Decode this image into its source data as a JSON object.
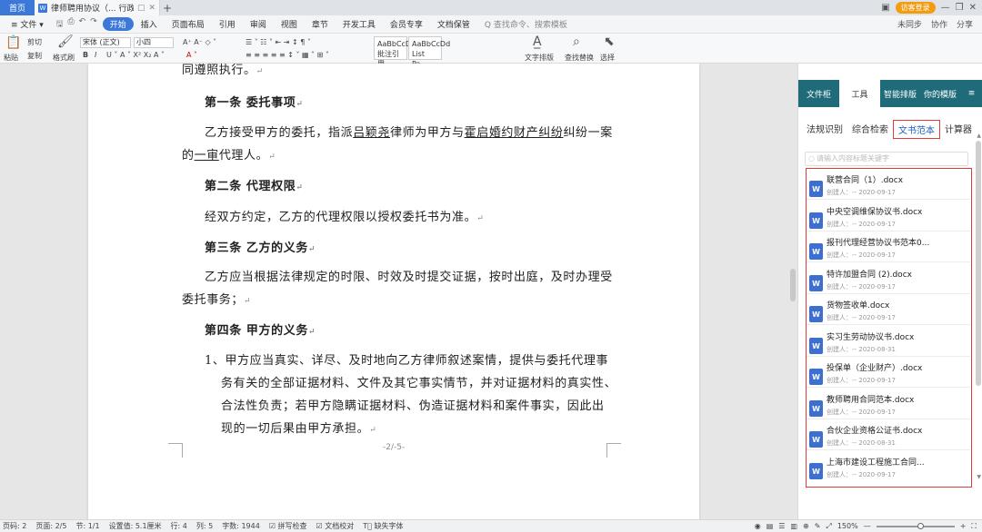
{
  "titlebar": {
    "home_tab": "首页",
    "doc_tab_icon": "W",
    "doc_tab": "律师聘用协议（... 行政）(1)",
    "login": "访客登录",
    "icons": [
      "window-icon",
      "minimize-icon",
      "restore-icon",
      "close-icon"
    ]
  },
  "menubar": {
    "file": "≡ 文件 ▾",
    "items": [
      "开始",
      "插入",
      "页面布局",
      "引用",
      "审阅",
      "视图",
      "章节",
      "开发工具",
      "会员专享",
      "文档保管"
    ],
    "active": "开始",
    "search_cmd": "Q 查找命令、搜索模板",
    "right": [
      "未同步",
      "协作",
      "分享"
    ]
  },
  "ribbon": {
    "paste": "粘贴",
    "cut": "剪切",
    "copy": "复制",
    "format_painter": "格式刷",
    "font": "宋体 (正文)",
    "size": "小四",
    "style1": "AaBbCcDd",
    "style1_name": "批注引用",
    "style2": "AaBbCcDd",
    "style2_name": "List Pa...",
    "text_layout": "文字排版",
    "find_replace": "查找替换",
    "select": "选择"
  },
  "document": {
    "line0": "同遵照执行。",
    "h1": "第一条  委托事项",
    "p1a_pre": "乙方接受甲方的委托，指派",
    "p1a_lawyer": "吕颖尧",
    "p1a_mid": "律师为甲方与",
    "p1a_case": "霍启婚约财产纠纷",
    "p1a_post": "纠纷一案",
    "p1b_pre": "的",
    "p1b_u": "一审",
    "p1b_post": "代理人。",
    "h2": "第二条  代理权限",
    "p2": "经双方约定，乙方的代理权限以授权委托书为准。",
    "h3": "第三条  乙方的义务",
    "p3a": "乙方应当根据法律规定的时限、时效及时提交证据，按时出庭，及时办理受",
    "p3b": "委托事务；",
    "h4": "第四条  甲方的义务",
    "p4a": "1、甲方应当真实、详尽、及时地向乙方律师叙述案情，提供与委托代理事",
    "p4b": "务有关的全部证据材料、文件及其它事实情节，并对证据材料的真实性、",
    "p4c": "合法性负责；若甲方隐瞒证据材料、伪造证据材料和案件事实，因此出",
    "p4d": "现的一切后果由甲方承担。",
    "footer": "-2/-5-"
  },
  "pane": {
    "tabs": [
      "文件柜",
      "工具",
      "智能排版",
      "你的模版",
      "≡"
    ],
    "active_tab": "工具",
    "subtabs": [
      "法规识别",
      "综合检索",
      "文书范本",
      "计算器"
    ],
    "active_subtab": "文书范本",
    "search_placeholder": "请输入内容标题关键字",
    "items": [
      {
        "name": "联营合同（1）.docx",
        "meta": "创建人：-- 2020-09-17"
      },
      {
        "name": "中央空调维保协议书.docx",
        "meta": "创建人：-- 2020-09-17"
      },
      {
        "name": "报刊代理经营协议书范本0...",
        "meta": "创建人：-- 2020-09-17"
      },
      {
        "name": "特许加盟合同 (2).docx",
        "meta": "创建人：-- 2020-09-17"
      },
      {
        "name": "货物签收单.docx",
        "meta": "创建人：-- 2020-09-17"
      },
      {
        "name": "实习生劳动协议书.docx",
        "meta": "创建人：-- 2020-08-31"
      },
      {
        "name": "投保单（企业财产）.docx",
        "meta": "创建人：-- 2020-09-17"
      },
      {
        "name": "教师聘用合同范本.docx",
        "meta": "创建人：-- 2020-09-17"
      },
      {
        "name": "合伙企业资格公证书.docx",
        "meta": "创建人：-- 2020-08-31"
      },
      {
        "name": "上海市建设工程施工合同...",
        "meta": "创建人：-- 2020-09-17"
      }
    ]
  },
  "statusbar": {
    "page_num": "页码: 2",
    "pages": "页面: 2/5",
    "section": "节: 1/1",
    "setting": "设置值: 5.1厘米",
    "row": "行: 4",
    "col": "列: 5",
    "words": "字数: 1944",
    "spell": "拼写检查",
    "proof": "文档校对",
    "font_missing": "缺失字体",
    "zoom": "150%",
    "zoom_level": 0.56
  },
  "colors": {
    "accent": "#3c78d8",
    "pane_tab_bg": "#1f6b7a",
    "highlight_box": "#e53935",
    "word_icon": "#3d6fd1"
  }
}
